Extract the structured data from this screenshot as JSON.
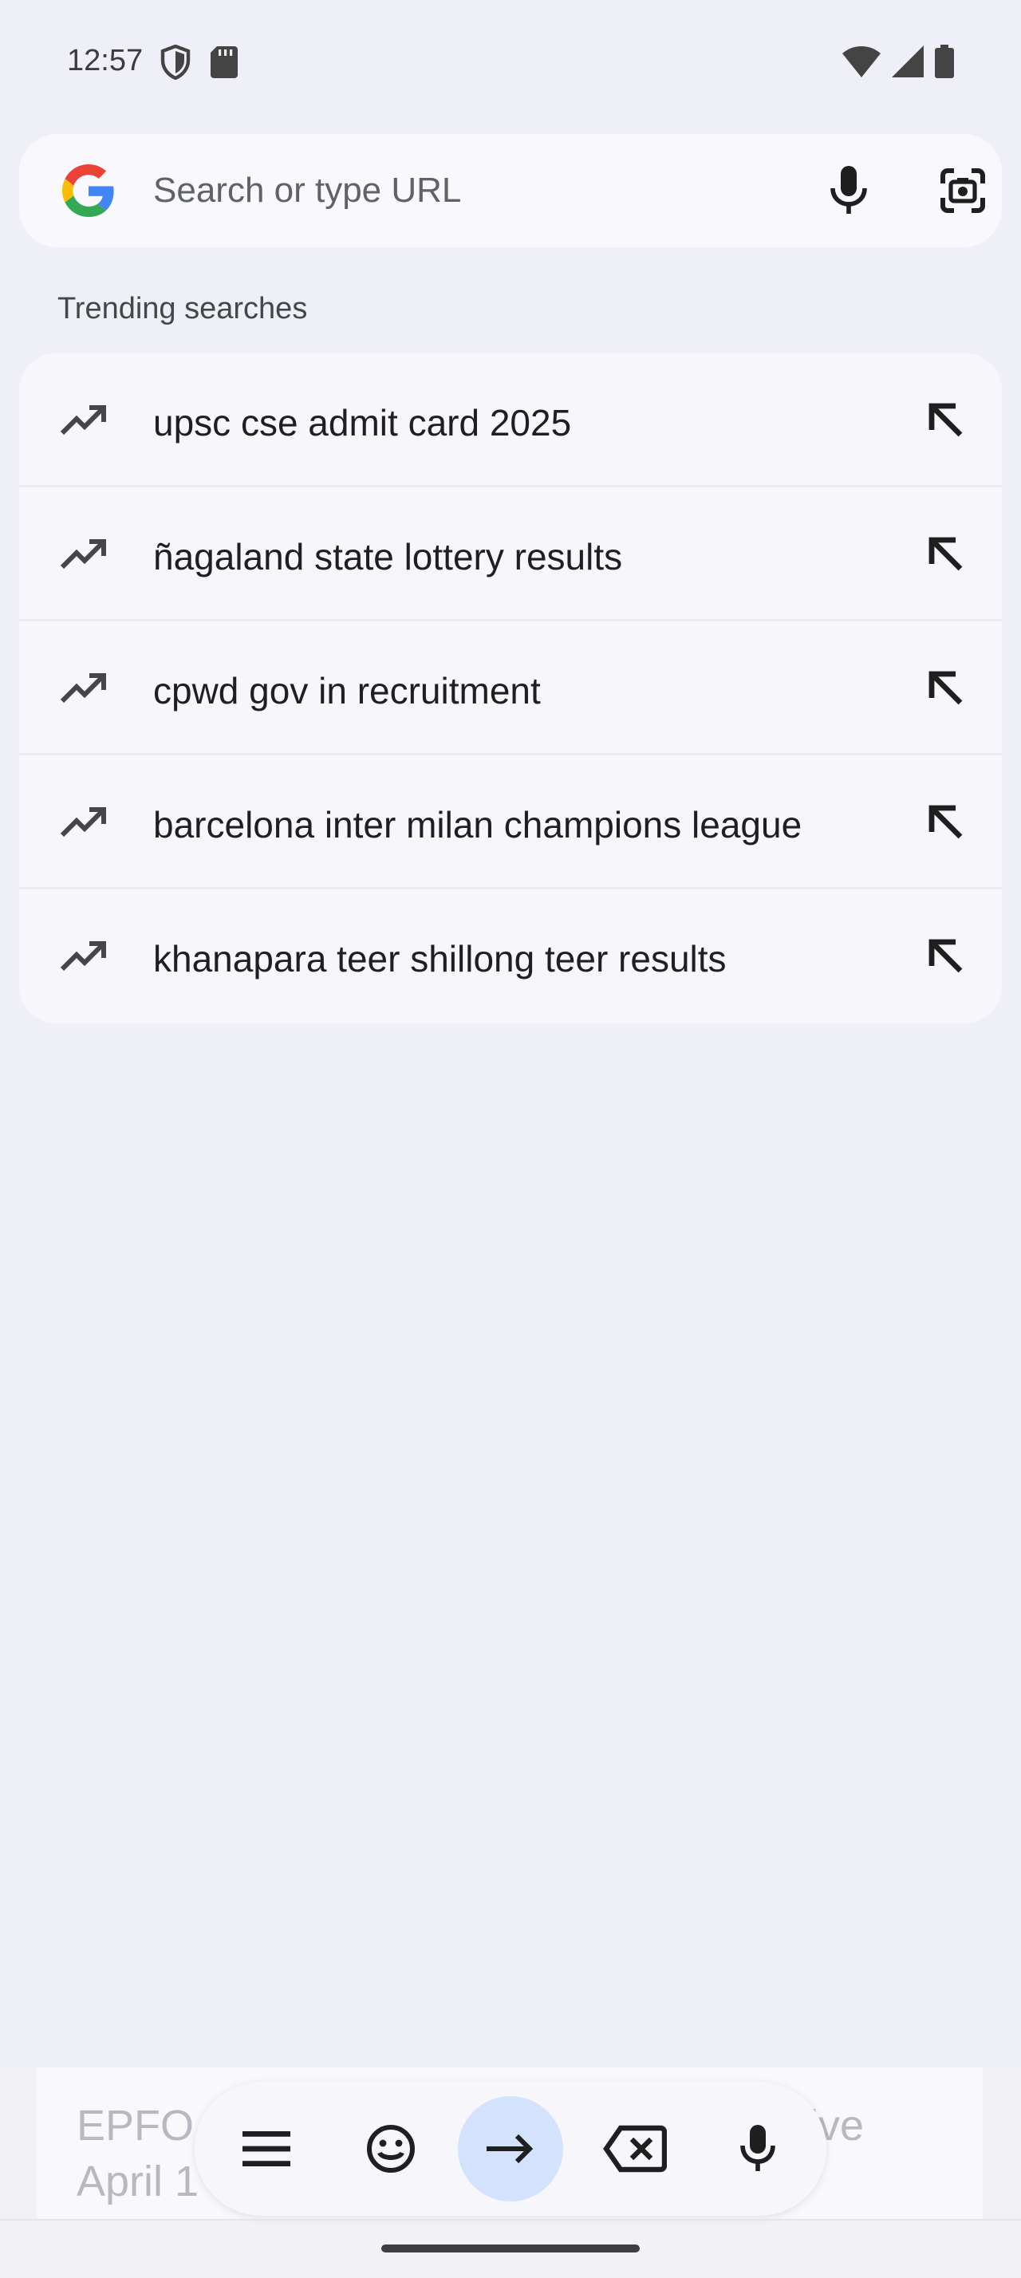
{
  "status_bar": {
    "time": "12:57",
    "left_icons": [
      "shield-icon",
      "sd-card-icon"
    ],
    "right_icons": [
      "wifi-icon",
      "cell-signal-icon",
      "battery-icon"
    ]
  },
  "search_bar": {
    "placeholder": "Search or type URL",
    "icons": [
      "google-logo",
      "mic-icon",
      "lens-camera-icon"
    ]
  },
  "trending": {
    "label": "Trending searches",
    "items": [
      {
        "text": "upsc cse admit card 2025"
      },
      {
        "text": "ñagaland state lottery results"
      },
      {
        "text": "cpwd gov in recruitment"
      },
      {
        "text": "barcelona inter milan champions league"
      },
      {
        "text": "khanapara teer shillong teer results"
      }
    ]
  },
  "keyboard": {
    "ghost_left_line1": "EPFO",
    "ghost_right_line1": "ctive",
    "ghost_left_line2": "April 1",
    "toolbar_icons": [
      "menu-icon",
      "emoji-icon",
      "arrow-right-icon",
      "backspace-icon",
      "mic-icon"
    ]
  },
  "colors": {
    "background": "#eff0f7",
    "card": "#f6f6fb",
    "accent_go": "#d3e3fd",
    "google_blue": "#4285F4",
    "google_red": "#EA4335",
    "google_yellow": "#FBBC05",
    "google_green": "#34A853"
  }
}
